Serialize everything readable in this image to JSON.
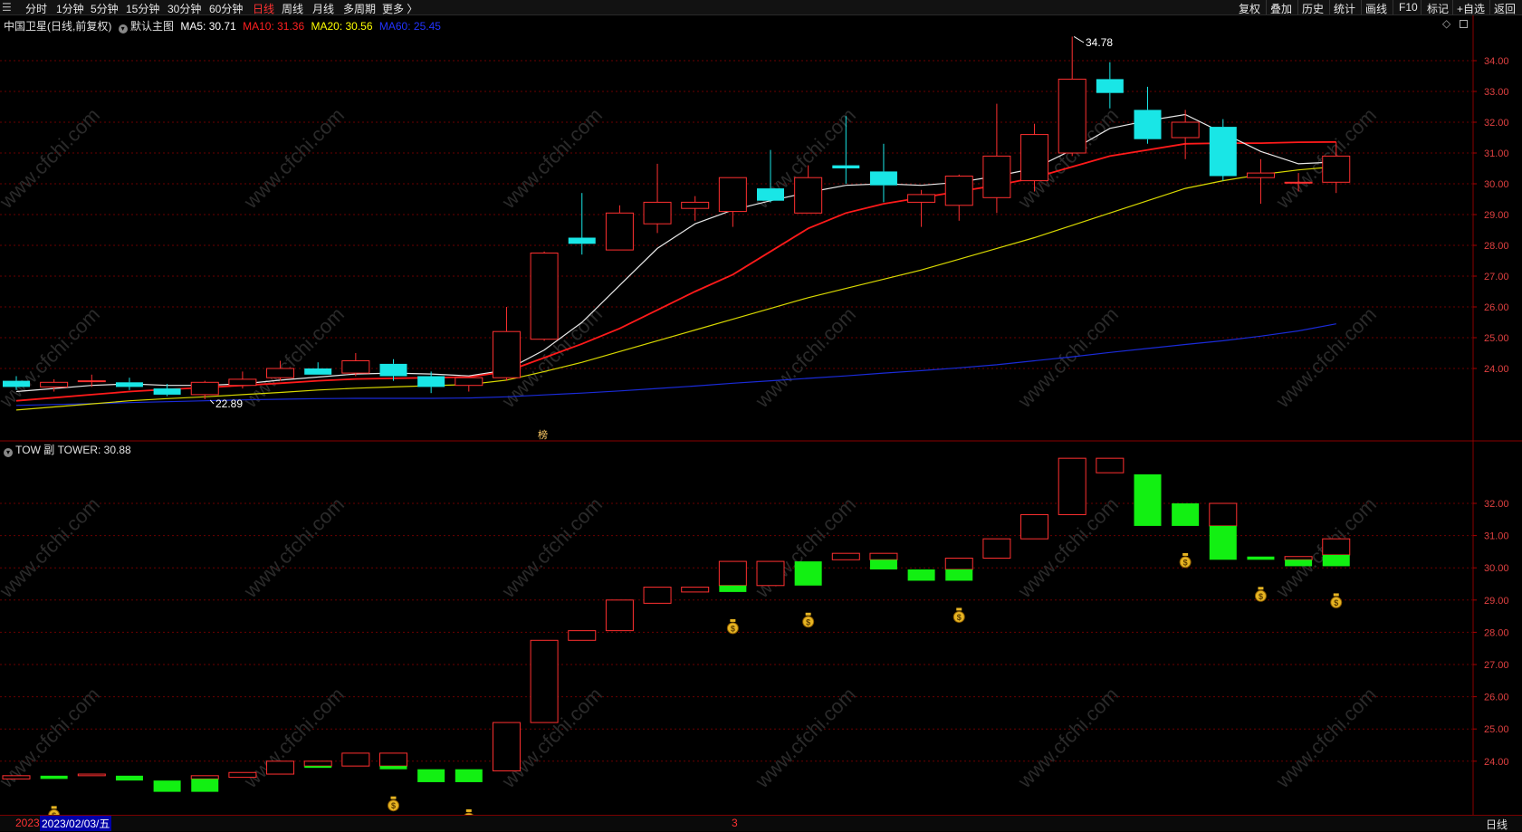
{
  "toolbar": {
    "left_tabs": [
      "分时",
      "1分钟",
      "5分钟",
      "15分钟",
      "30分钟",
      "60分钟",
      "日线",
      "周线",
      "月线",
      "多周期",
      "更多 〉"
    ],
    "active": "日线",
    "right_tabs": [
      "复权",
      "叠加",
      "历史",
      "统计",
      "画线",
      "F10",
      "标记",
      "+自选",
      "返回"
    ]
  },
  "main_panel": {
    "stock": "中国卫星(日线,前复权)",
    "template": "默认主图",
    "ma": [
      {
        "label": "MA5: 30.71",
        "color": "#ffffff"
      },
      {
        "label": "MA10: 31.36",
        "color": "#ff2020"
      },
      {
        "label": "MA20: 30.56",
        "color": "#ffff00"
      },
      {
        "label": "MA60: 25.45",
        "color": "#2233ff"
      }
    ],
    "high_label": "34.78",
    "low_label": "22.89",
    "marker_char": "榜"
  },
  "sub_panel": {
    "title": "TOW 副 TOWER: 30.88"
  },
  "footer": {
    "date_left": "2023",
    "date_cursor": "2023/02/03/五",
    "date_mid": "3",
    "period": "日线"
  },
  "chart_data": [
    {
      "type": "candlestick",
      "ylim": [
        21.8,
        35.4
      ],
      "yticks": [
        "34.00",
        "33.00",
        "32.00",
        "31.00",
        "30.00",
        "29.00",
        "28.00",
        "27.00",
        "26.00",
        "25.00",
        "24.00"
      ],
      "candles": [
        {
          "o": 23.6,
          "h": 23.75,
          "l": 23.3,
          "c": 23.4
        },
        {
          "o": 23.4,
          "h": 23.65,
          "l": 23.25,
          "c": 23.55
        },
        {
          "o": 23.6,
          "h": 23.8,
          "l": 23.4,
          "c": 23.6
        },
        {
          "o": 23.55,
          "h": 23.7,
          "l": 23.3,
          "c": 23.4
        },
        {
          "o": 23.35,
          "h": 23.5,
          "l": 23.1,
          "c": 23.15
        },
        {
          "o": 23.15,
          "h": 23.6,
          "l": 23.0,
          "c": 23.55
        },
        {
          "o": 23.45,
          "h": 23.9,
          "l": 23.35,
          "c": 23.65
        },
        {
          "o": 23.7,
          "h": 24.25,
          "l": 23.6,
          "c": 24.0
        },
        {
          "o": 24.0,
          "h": 24.2,
          "l": 23.8,
          "c": 23.8
        },
        {
          "o": 23.85,
          "h": 24.5,
          "l": 23.75,
          "c": 24.25
        },
        {
          "o": 24.15,
          "h": 24.3,
          "l": 23.6,
          "c": 23.75
        },
        {
          "o": 23.75,
          "h": 23.9,
          "l": 23.2,
          "c": 23.4
        },
        {
          "o": 23.45,
          "h": 23.7,
          "l": 23.25,
          "c": 23.7
        },
        {
          "o": 23.7,
          "h": 26.0,
          "l": 23.6,
          "c": 25.2
        },
        {
          "o": 24.95,
          "h": 27.8,
          "l": 24.9,
          "c": 27.75
        },
        {
          "o": 28.25,
          "h": 29.7,
          "l": 27.7,
          "c": 28.05
        },
        {
          "o": 27.85,
          "h": 29.3,
          "l": 27.85,
          "c": 29.05
        },
        {
          "o": 28.7,
          "h": 30.65,
          "l": 28.4,
          "c": 29.4
        },
        {
          "o": 29.2,
          "h": 29.6,
          "l": 28.8,
          "c": 29.4
        },
        {
          "o": 29.1,
          "h": 30.2,
          "l": 28.6,
          "c": 30.2
        },
        {
          "o": 29.85,
          "h": 31.1,
          "l": 29.4,
          "c": 29.45
        },
        {
          "o": 29.05,
          "h": 30.6,
          "l": 29.05,
          "c": 30.2
        },
        {
          "o": 30.6,
          "h": 32.2,
          "l": 30.0,
          "c": 30.5
        },
        {
          "o": 30.4,
          "h": 31.3,
          "l": 29.4,
          "c": 29.95
        },
        {
          "o": 29.4,
          "h": 29.8,
          "l": 28.6,
          "c": 29.65
        },
        {
          "o": 29.3,
          "h": 30.3,
          "l": 28.8,
          "c": 30.25
        },
        {
          "o": 29.55,
          "h": 32.6,
          "l": 29.05,
          "c": 30.9
        },
        {
          "o": 30.1,
          "h": 31.95,
          "l": 29.75,
          "c": 31.6
        },
        {
          "o": 31.0,
          "h": 34.78,
          "l": 30.9,
          "c": 33.4
        },
        {
          "o": 33.4,
          "h": 33.95,
          "l": 32.45,
          "c": 32.95
        },
        {
          "o": 32.4,
          "h": 33.15,
          "l": 31.3,
          "c": 31.45
        },
        {
          "o": 31.5,
          "h": 32.4,
          "l": 30.8,
          "c": 32.0
        },
        {
          "o": 31.85,
          "h": 32.1,
          "l": 30.1,
          "c": 30.25
        },
        {
          "o": 30.2,
          "h": 30.8,
          "l": 29.35,
          "c": 30.35
        },
        {
          "o": 30.05,
          "h": 30.35,
          "l": 29.75,
          "c": 30.05
        },
        {
          "o": 30.05,
          "h": 31.35,
          "l": 29.7,
          "c": 30.9
        }
      ],
      "ma5": [
        23.25,
        23.35,
        23.45,
        23.5,
        23.45,
        23.45,
        23.5,
        23.62,
        23.72,
        23.82,
        23.85,
        23.82,
        23.76,
        23.95,
        24.6,
        25.5,
        26.7,
        27.9,
        28.7,
        29.15,
        29.45,
        29.72,
        29.95,
        30.0,
        29.95,
        30.05,
        30.25,
        30.5,
        31.1,
        31.8,
        32.05,
        32.25,
        31.65,
        31.05,
        30.65,
        30.71
      ],
      "ma10": [
        22.95,
        23.05,
        23.15,
        23.25,
        23.32,
        23.38,
        23.45,
        23.52,
        23.6,
        23.66,
        23.68,
        23.7,
        23.72,
        23.9,
        24.35,
        24.8,
        25.3,
        25.9,
        26.5,
        27.05,
        27.8,
        28.55,
        29.05,
        29.35,
        29.55,
        29.75,
        29.95,
        30.2,
        30.55,
        30.9,
        31.1,
        31.3,
        31.32,
        31.32,
        31.35,
        31.36
      ],
      "ma20": [
        22.65,
        22.75,
        22.85,
        22.95,
        23.02,
        23.08,
        23.15,
        23.22,
        23.3,
        23.36,
        23.4,
        23.44,
        23.48,
        23.62,
        23.9,
        24.2,
        24.55,
        24.9,
        25.25,
        25.6,
        25.95,
        26.3,
        26.6,
        26.9,
        27.2,
        27.55,
        27.9,
        28.25,
        28.65,
        29.05,
        29.45,
        29.85,
        30.1,
        30.3,
        30.45,
        30.56
      ],
      "ma60": [
        22.8,
        22.83,
        22.86,
        22.89,
        22.92,
        22.95,
        22.98,
        23.0,
        23.02,
        23.03,
        23.03,
        23.03,
        23.04,
        23.08,
        23.14,
        23.2,
        23.27,
        23.35,
        23.43,
        23.52,
        23.6,
        23.68,
        23.76,
        23.85,
        23.93,
        24.02,
        24.12,
        24.25,
        24.38,
        24.52,
        24.65,
        24.78,
        24.9,
        25.05,
        25.22,
        25.45
      ]
    },
    {
      "type": "bar",
      "ylim": [
        22.9,
        33.5
      ],
      "yticks": [
        "32.00",
        "31.00",
        "30.00",
        "29.00",
        "28.00",
        "27.00",
        "26.00",
        "25.00",
        "24.00"
      ],
      "tower": [
        {
          "a": 23.55,
          "b": 23.45,
          "up": true
        },
        {
          "a": 23.55,
          "b": 23.45,
          "up": false
        },
        {
          "a": 23.6,
          "b": 23.55,
          "up": true
        },
        {
          "a": 23.55,
          "b": 23.4,
          "up": false
        },
        {
          "a": 23.4,
          "b": 23.05,
          "up": false
        },
        {
          "a": 23.55,
          "b": 23.05,
          "up": false,
          "split": 23.45
        },
        {
          "a": 23.65,
          "b": 23.5,
          "up": true
        },
        {
          "a": 24.0,
          "b": 23.6,
          "up": true
        },
        {
          "a": 24.0,
          "b": 23.85,
          "up": false,
          "split": 23.85
        },
        {
          "a": 24.25,
          "b": 23.85,
          "up": true
        },
        {
          "a": 24.25,
          "b": 23.75,
          "up": false,
          "split": 23.85
        },
        {
          "a": 23.75,
          "b": 23.35,
          "up": false
        },
        {
          "a": 23.75,
          "b": 23.35,
          "up": false
        },
        {
          "a": 25.2,
          "b": 23.7,
          "up": true
        },
        {
          "a": 27.75,
          "b": 25.2,
          "up": true
        },
        {
          "a": 28.05,
          "b": 27.75,
          "up": true
        },
        {
          "a": 29.0,
          "b": 28.05,
          "up": true
        },
        {
          "a": 29.4,
          "b": 28.9,
          "up": true
        },
        {
          "a": 29.4,
          "b": 29.25,
          "up": true
        },
        {
          "a": 30.2,
          "b": 29.25,
          "up": true,
          "split": 29.45
        },
        {
          "a": 30.2,
          "b": 29.45,
          "up": true
        },
        {
          "a": 30.2,
          "b": 29.45,
          "up": false
        },
        {
          "a": 30.45,
          "b": 30.25,
          "up": true
        },
        {
          "a": 30.45,
          "b": 29.95,
          "up": true,
          "split": 30.25
        },
        {
          "a": 29.95,
          "b": 29.6,
          "up": false
        },
        {
          "a": 30.3,
          "b": 29.6,
          "up": true,
          "split": 29.95
        },
        {
          "a": 30.9,
          "b": 30.3,
          "up": true
        },
        {
          "a": 31.65,
          "b": 30.9,
          "up": true
        },
        {
          "a": 33.4,
          "b": 31.65,
          "up": true
        },
        {
          "a": 33.4,
          "b": 32.95,
          "up": true
        },
        {
          "a": 32.9,
          "b": 31.3,
          "up": false
        },
        {
          "a": 32.0,
          "b": 31.3,
          "up": false
        },
        {
          "a": 32.0,
          "b": 30.25,
          "up": false,
          "split": 31.3
        },
        {
          "a": 30.35,
          "b": 30.25,
          "up": false
        },
        {
          "a": 30.35,
          "b": 30.05,
          "up": false,
          "split": 30.25
        },
        {
          "a": 30.9,
          "b": 30.05,
          "up": false,
          "split": 30.4
        }
      ],
      "money_bags": [
        1,
        10,
        12,
        19,
        21,
        25,
        31,
        33,
        35
      ]
    }
  ]
}
